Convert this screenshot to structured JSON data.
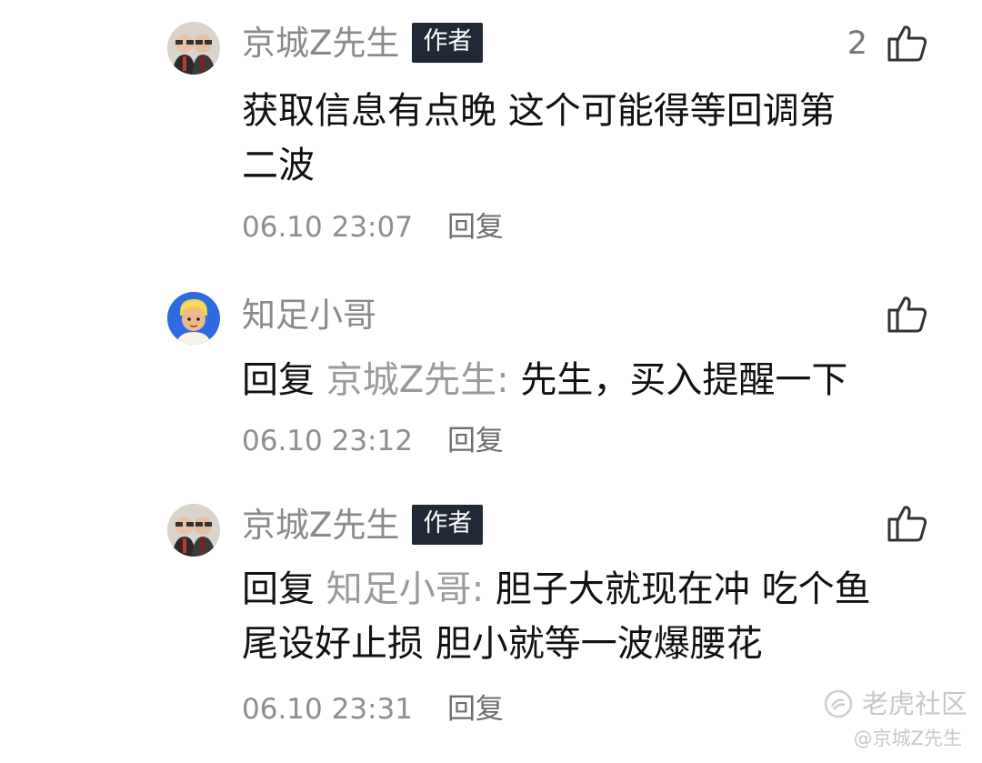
{
  "comments": [
    {
      "username": "京城Z先生",
      "badge": "作者",
      "like_count": "2",
      "text_line1": "获取信息有点晚 这个可能得等回调第",
      "text_line2": "二波",
      "timestamp": "06.10 23:07",
      "reply_label": "回复",
      "avatar_icon": "avatar-two-men-icon",
      "like_icon": "thumbs-up-outline-icon"
    },
    {
      "username": "知足小哥",
      "reply_prefix": "回复",
      "reply_target": "京城Z先生:",
      "text": "先生，买入提醒一下",
      "timestamp": "06.10 23:12",
      "reply_label": "回复",
      "avatar_icon": "avatar-cartoon-boy-icon",
      "like_icon": "thumbs-up-outline-icon"
    },
    {
      "username": "京城Z先生",
      "badge": "作者",
      "reply_prefix": "回复",
      "reply_target": "知足小哥:",
      "text_line1": "胆子大就现在冲 吃个鱼",
      "text_line2": "尾设好止损 胆小就等一波爆腰花",
      "timestamp": "06.10 23:31",
      "reply_label": "回复",
      "avatar_icon": "avatar-two-men-icon",
      "like_icon": "thumbs-up-outline-icon"
    }
  ],
  "watermark": {
    "brand": "老虎社区",
    "handle": "@京城Z先生",
    "icon": "tiger-community-logo-icon"
  },
  "colors": {
    "username_gray": "#8a8a8a",
    "badge_bg": "#1f2a36",
    "badge_text": "#ffffff",
    "body_text": "#111111",
    "meta_gray": "#8e8e8e",
    "watermark_gray": "#c9c9c9"
  }
}
